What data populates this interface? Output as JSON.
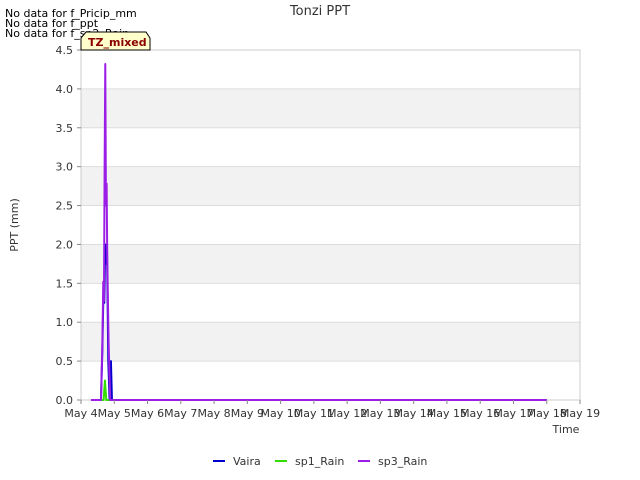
{
  "messages": [
    "No data for f_Pricip_mm",
    "No data for f_ppt",
    "No data for f_sp2_Rain"
  ],
  "chart_data": {
    "type": "line",
    "title": "Tonzi PPT",
    "xlabel": "Time",
    "ylabel": "PPT (mm)",
    "badge": "TZ_mixed",
    "xlim": [
      4,
      19
    ],
    "ylim": [
      0,
      4.5
    ],
    "xticks": [
      {
        "value": 4,
        "label": "May 4"
      },
      {
        "value": 5,
        "label": "May 5"
      },
      {
        "value": 6,
        "label": "May 6"
      },
      {
        "value": 7,
        "label": "May 7"
      },
      {
        "value": 8,
        "label": "May 8"
      },
      {
        "value": 9,
        "label": "May 9"
      },
      {
        "value": 10,
        "label": "May 10"
      },
      {
        "value": 11,
        "label": "May 11"
      },
      {
        "value": 12,
        "label": "May 12"
      },
      {
        "value": 13,
        "label": "May 13"
      },
      {
        "value": 14,
        "label": "May 14"
      },
      {
        "value": 15,
        "label": "May 15"
      },
      {
        "value": 16,
        "label": "May 16"
      },
      {
        "value": 17,
        "label": "May 17"
      },
      {
        "value": 18,
        "label": "May 18"
      },
      {
        "value": 19,
        "label": "May 19"
      }
    ],
    "yticks": [
      "0.0",
      "0.5",
      "1.0",
      "1.5",
      "2.0",
      "2.5",
      "3.0",
      "3.5",
      "4.0",
      "4.5"
    ],
    "grid": true,
    "legend_position": "bottom",
    "series": [
      {
        "name": "Vaira",
        "color": "#0000cc",
        "points": [
          [
            4.3,
            0
          ],
          [
            4.6,
            0
          ],
          [
            4.64,
            0.6
          ],
          [
            4.68,
            1.5
          ],
          [
            4.7,
            1.25
          ],
          [
            4.72,
            1.8
          ],
          [
            4.74,
            2.0
          ],
          [
            4.76,
            1.75
          ],
          [
            4.78,
            2.0
          ],
          [
            4.82,
            0.5
          ],
          [
            4.86,
            0
          ],
          [
            4.9,
            0.5
          ],
          [
            4.93,
            0
          ],
          [
            18.0,
            0
          ]
        ]
      },
      {
        "name": "sp1_Rain",
        "color": "#33dd00",
        "points": [
          [
            4.3,
            0
          ],
          [
            4.68,
            0
          ],
          [
            4.72,
            0.25
          ],
          [
            4.76,
            0
          ],
          [
            18.0,
            0
          ]
        ]
      },
      {
        "name": "sp3_Rain",
        "color": "#9b1ee6",
        "points": [
          [
            4.3,
            0
          ],
          [
            4.6,
            0
          ],
          [
            4.64,
            0.7
          ],
          [
            4.67,
            1.52
          ],
          [
            4.69,
            1.27
          ],
          [
            4.71,
            3.0
          ],
          [
            4.73,
            4.32
          ],
          [
            4.75,
            2.5
          ],
          [
            4.77,
            2.78
          ],
          [
            4.79,
            1.8
          ],
          [
            4.83,
            0.75
          ],
          [
            4.86,
            0.25
          ],
          [
            4.88,
            0
          ],
          [
            18.0,
            0
          ]
        ]
      }
    ]
  }
}
